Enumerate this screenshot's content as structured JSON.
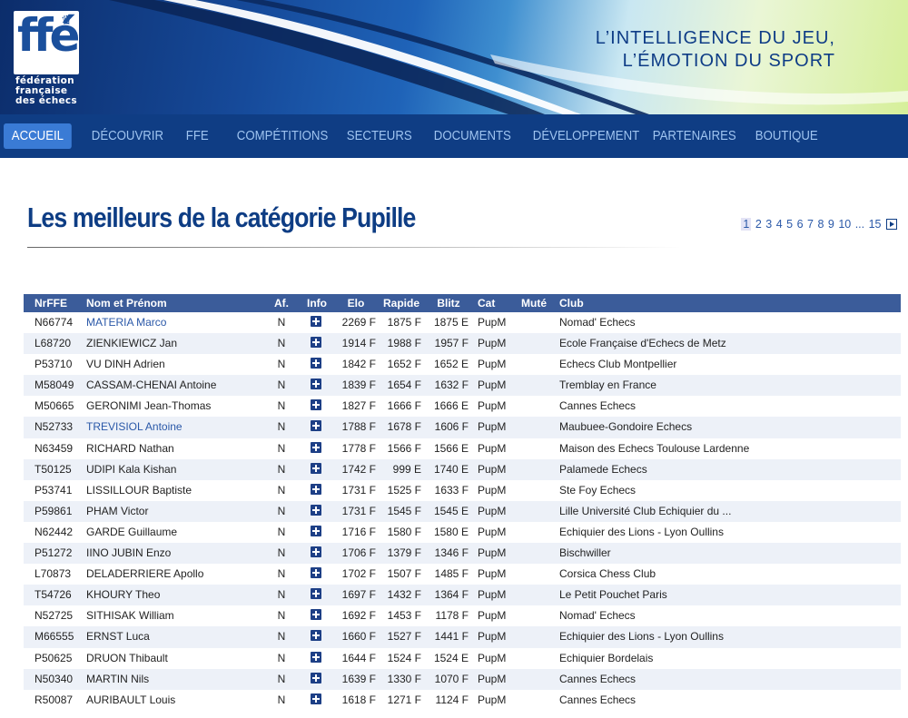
{
  "logo": {
    "letters": "ffé",
    "crown": "♛",
    "line1": "fédération",
    "line2": "française",
    "line3": "des échecs"
  },
  "slogan": {
    "line1": "L’INTELLIGENCE DU JEU,",
    "line2": "L’ÉMOTION DU SPORT"
  },
  "nav": {
    "items": [
      {
        "label": "ACCUEIL",
        "active": true
      },
      {
        "label": "DÉCOUVRIR"
      },
      {
        "label": "FFE"
      },
      {
        "label": "COMPÉTITIONS"
      },
      {
        "label": "SECTEURS"
      },
      {
        "label": "DOCUMENTS"
      },
      {
        "label": "DÉVELOPPEMENT"
      },
      {
        "label": "PARTENAIRES"
      },
      {
        "label": "BOUTIQUE"
      }
    ]
  },
  "page_title": "Les meilleurs de la catégorie Pupille",
  "pager": {
    "pages": [
      "1",
      "2",
      "3",
      "4",
      "5",
      "6",
      "7",
      "8",
      "9",
      "10"
    ],
    "current": "1",
    "ellipsis": "...",
    "last": "15"
  },
  "table": {
    "headers": {
      "nr": "NrFFE",
      "name": "Nom et Prénom",
      "af": "Af.",
      "info": "Info",
      "elo": "Elo",
      "rapide": "Rapide",
      "blitz": "Blitz",
      "cat": "Cat",
      "mute": "Muté",
      "club": "Club"
    },
    "rows": [
      {
        "nr": "N66774",
        "name": "MATERIA Marco",
        "link": true,
        "af": "N",
        "elo": "2269 F",
        "rapide": "1875 F",
        "blitz": "1875 E",
        "cat": "PupM",
        "mute": "",
        "club": "Nomad' Echecs"
      },
      {
        "nr": "L68720",
        "name": "ZIENKIEWICZ Jan",
        "af": "N",
        "elo": "1914 F",
        "rapide": "1988 F",
        "blitz": "1957 F",
        "cat": "PupM",
        "mute": "",
        "club": "Ecole Française d'Echecs de Metz"
      },
      {
        "nr": "P53710",
        "name": "VU DINH Adrien",
        "af": "N",
        "elo": "1842 F",
        "rapide": "1652 F",
        "blitz": "1652 E",
        "cat": "PupM",
        "mute": "",
        "club": "Echecs Club Montpellier"
      },
      {
        "nr": "M58049",
        "name": "CASSAM-CHENAI Antoine",
        "af": "N",
        "elo": "1839 F",
        "rapide": "1654 F",
        "blitz": "1632 F",
        "cat": "PupM",
        "mute": "",
        "club": "Tremblay en France"
      },
      {
        "nr": "M50665",
        "name": "GERONIMI Jean-Thomas",
        "af": "N",
        "elo": "1827 F",
        "rapide": "1666 F",
        "blitz": "1666 E",
        "cat": "PupM",
        "mute": "",
        "club": "Cannes Echecs"
      },
      {
        "nr": "N52733",
        "name": "TREVISIOL Antoine",
        "link": true,
        "af": "N",
        "elo": "1788 F",
        "rapide": "1678 F",
        "blitz": "1606 F",
        "cat": "PupM",
        "mute": "",
        "club": "Maubuee-Gondoire Echecs"
      },
      {
        "nr": "N63459",
        "name": "RICHARD Nathan",
        "af": "N",
        "elo": "1778 F",
        "rapide": "1566 F",
        "blitz": "1566 E",
        "cat": "PupM",
        "mute": "",
        "club": "Maison des Echecs Toulouse Lardenne"
      },
      {
        "nr": "T50125",
        "name": "UDIPI Kala Kishan",
        "af": "N",
        "elo": "1742 F",
        "rapide": "999 E",
        "blitz": "1740 E",
        "cat": "PupM",
        "mute": "",
        "club": "Palamede Echecs"
      },
      {
        "nr": "P53741",
        "name": "LISSILLOUR Baptiste",
        "af": "N",
        "elo": "1731 F",
        "rapide": "1525 F",
        "blitz": "1633 F",
        "cat": "PupM",
        "mute": "",
        "club": "Ste Foy Echecs"
      },
      {
        "nr": "P59861",
        "name": "PHAM Victor",
        "af": "N",
        "elo": "1731 F",
        "rapide": "1545 F",
        "blitz": "1545 E",
        "cat": "PupM",
        "mute": "",
        "club": "Lille Université Club Echiquier du ..."
      },
      {
        "nr": "N62442",
        "name": "GARDE Guillaume",
        "af": "N",
        "elo": "1716 F",
        "rapide": "1580 F",
        "blitz": "1580 E",
        "cat": "PupM",
        "mute": "",
        "club": "Echiquier des Lions - Lyon Oullins"
      },
      {
        "nr": "P51272",
        "name": "IINO JUBIN Enzo",
        "af": "N",
        "elo": "1706 F",
        "rapide": "1379 F",
        "blitz": "1346 F",
        "cat": "PupM",
        "mute": "",
        "club": "Bischwiller"
      },
      {
        "nr": "L70873",
        "name": "DELADERRIERE Apollo",
        "af": "N",
        "elo": "1702 F",
        "rapide": "1507 F",
        "blitz": "1485 F",
        "cat": "PupM",
        "mute": "",
        "club": "Corsica Chess Club"
      },
      {
        "nr": "T54726",
        "name": "KHOURY Theo",
        "af": "N",
        "elo": "1697 F",
        "rapide": "1432 F",
        "blitz": "1364 F",
        "cat": "PupM",
        "mute": "",
        "club": "Le Petit Pouchet Paris"
      },
      {
        "nr": "N52725",
        "name": "SITHISAK William",
        "af": "N",
        "elo": "1692 F",
        "rapide": "1453 F",
        "blitz": "1178 F",
        "cat": "PupM",
        "mute": "",
        "club": "Nomad' Echecs"
      },
      {
        "nr": "M66555",
        "name": "ERNST Luca",
        "af": "N",
        "elo": "1660 F",
        "rapide": "1527 F",
        "blitz": "1441 F",
        "cat": "PupM",
        "mute": "",
        "club": "Echiquier des Lions - Lyon Oullins"
      },
      {
        "nr": "P50625",
        "name": "DRUON Thibault",
        "af": "N",
        "elo": "1644 F",
        "rapide": "1524 F",
        "blitz": "1524 E",
        "cat": "PupM",
        "mute": "",
        "club": "Echiquier Bordelais"
      },
      {
        "nr": "N50340",
        "name": "MARTIN Nils",
        "af": "N",
        "elo": "1639 F",
        "rapide": "1330 F",
        "blitz": "1070 F",
        "cat": "PupM",
        "mute": "",
        "club": "Cannes Echecs"
      },
      {
        "nr": "R50087",
        "name": "AURIBAULT Louis",
        "af": "N",
        "elo": "1618 F",
        "rapide": "1271 F",
        "blitz": "1124 F",
        "cat": "PupM",
        "mute": "",
        "club": "Cannes Echecs"
      }
    ]
  },
  "colors": {
    "brand_blue": "#0e3d84",
    "nav_active": "#3a7bd5",
    "table_header": "#3b5c9a",
    "row_alt": "#edf1f8",
    "link": "#2a58a8"
  }
}
